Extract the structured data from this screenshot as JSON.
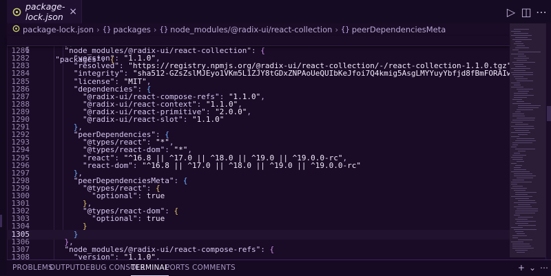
{
  "tab": {
    "title": "package-lock.json",
    "close_glyph": "×"
  },
  "editor_actions": [
    {
      "name": "run-icon",
      "glyph": "▷"
    },
    {
      "name": "split-editor-icon",
      "glyph": "◫"
    },
    {
      "name": "more-actions-icon",
      "glyph": "⋯"
    }
  ],
  "breadcrumbs": [
    {
      "label": "package-lock.json",
      "icon": "json-file-icon",
      "braces": ""
    },
    {
      "label": "packages",
      "icon": "object-icon",
      "braces": "{}"
    },
    {
      "label": "node_modules/@radix-ui/react-collection",
      "icon": "object-icon",
      "braces": "{}"
    },
    {
      "label": "peerDependenciesMeta",
      "icon": "object-icon",
      "braces": "{}"
    }
  ],
  "sticky": {
    "number": "6",
    "text": "  \"packages\": {"
  },
  "current_line": "1305",
  "lines": [
    {
      "n": "1280",
      "t": "    },"
    },
    {
      "n": "1281",
      "t": "    \"node_modules/@radix-ui/react-collection\": {"
    },
    {
      "n": "1282",
      "t": "      \"version\": \"1.1.0\","
    },
    {
      "n": "1283",
      "t": "      \"resolved\": \"https://registry.npmjs.org/@radix-ui/react-collection/-/react-collection-1.1.0.tgz\","
    },
    {
      "n": "1284",
      "t": "      \"integrity\": \"sha512-GZsZslMJEyo1VKm5L1ZJY8tGDxZNPAoUeQUIbKeJfoi7Q4kmig5AsgLMYYuyYbfjd8fBmFORAIwYAkXMnXZgZw==\","
    },
    {
      "n": "1285",
      "t": "      \"license\": \"MIT\","
    },
    {
      "n": "1286",
      "t": "      \"dependencies\": {"
    },
    {
      "n": "1287",
      "t": "        \"@radix-ui/react-compose-refs\": \"1.1.0\","
    },
    {
      "n": "1288",
      "t": "        \"@radix-ui/react-context\": \"1.1.0\","
    },
    {
      "n": "1289",
      "t": "        \"@radix-ui/react-primitive\": \"2.0.0\","
    },
    {
      "n": "1290",
      "t": "        \"@radix-ui/react-slot\": \"1.1.0\""
    },
    {
      "n": "1291",
      "t": "      },"
    },
    {
      "n": "1292",
      "t": "      \"peerDependencies\": {"
    },
    {
      "n": "1293",
      "t": "        \"@types/react\": \"*\","
    },
    {
      "n": "1294",
      "t": "        \"@types/react-dom\": \"*\","
    },
    {
      "n": "1295",
      "t": "        \"react\": \"^16.8 || ^17.0 || ^18.0 || ^19.0 || ^19.0.0-rc\","
    },
    {
      "n": "1296",
      "t": "        \"react-dom\": \"^16.8 || ^17.0 || ^18.0 || ^19.0 || ^19.0.0-rc\""
    },
    {
      "n": "1297",
      "t": "      },"
    },
    {
      "n": "1298",
      "t": "      \"peerDependenciesMeta\": {"
    },
    {
      "n": "1299",
      "t": "        \"@types/react\": {"
    },
    {
      "n": "1300",
      "t": "          \"optional\": true"
    },
    {
      "n": "1301",
      "t": "        },"
    },
    {
      "n": "1302",
      "t": "        \"@types/react-dom\": {"
    },
    {
      "n": "1303",
      "t": "          \"optional\": true"
    },
    {
      "n": "1304",
      "t": "        }"
    },
    {
      "n": "1305",
      "t": "      }"
    },
    {
      "n": "1306",
      "t": "    },"
    },
    {
      "n": "1307",
      "t": "    \"node_modules/@radix-ui/react-compose-refs\": {"
    },
    {
      "n": "1308",
      "t": "      \"version\": \"1.1.0\","
    }
  ],
  "panel": {
    "tabs": [
      "PROBLEMS",
      "OUTPUT",
      "DEBUG CONSOLE",
      "TERMINAL",
      "PORTS",
      "COMMENTS"
    ],
    "active": "TERMINAL",
    "actions": [
      {
        "name": "new-terminal-icon",
        "glyph": "+"
      },
      {
        "name": "terminal-dropdown-icon",
        "glyph": "⌄"
      },
      {
        "name": "panel-more-icon",
        "glyph": "⋯"
      }
    ]
  },
  "colors": {
    "accent": "#e3c66b",
    "background": "#1a0b26",
    "keys": "#d7c9f2",
    "brackets_level1": "#e3c66b",
    "brackets_level2": "#c98ae6",
    "brackets_level3": "#6fb3ff"
  }
}
